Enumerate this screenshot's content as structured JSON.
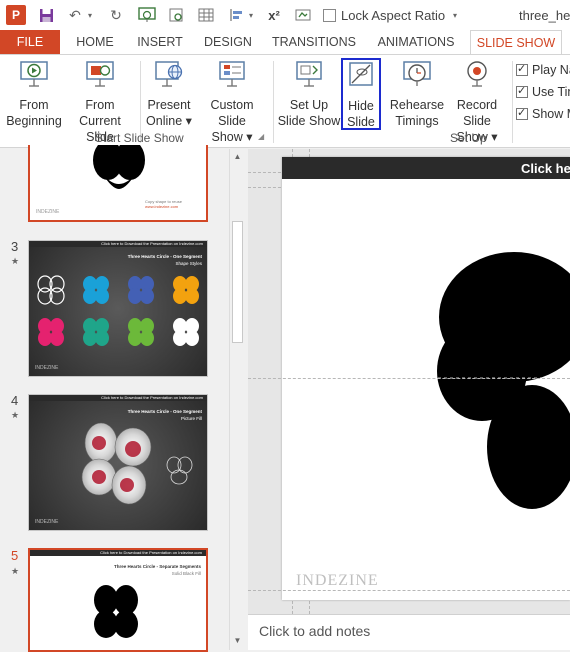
{
  "qat": {
    "lock_label": "Lock Aspect Ratio",
    "doc_title": "three_hea",
    "ppt_letter": "P",
    "superscript_label": "x²"
  },
  "tabs": [
    "FILE",
    "HOME",
    "INSERT",
    "DESIGN",
    "TRANSITIONS",
    "ANIMATIONS",
    "SLIDE SHOW"
  ],
  "active_tab": "SLIDE SHOW",
  "ribbon": {
    "from_beginning": [
      "From",
      "Beginning"
    ],
    "from_current": [
      "From",
      "Current Slide"
    ],
    "present_online": [
      "Present",
      "Online ▾"
    ],
    "custom_slide_show": [
      "Custom Slide",
      "Show ▾"
    ],
    "setup_slide_show": [
      "Set Up",
      "Slide Show"
    ],
    "hide_slide": [
      "Hide",
      "Slide"
    ],
    "rehearse_timings": [
      "Rehearse",
      "Timings"
    ],
    "record_slide_show": [
      "Record Slide",
      "Show ▾"
    ],
    "group_start": "Start Slide Show",
    "group_setup": "Set Up",
    "checks": [
      "Play Na",
      "Use Tin",
      "Show M"
    ]
  },
  "thumbnails": {
    "numbers": [
      "3",
      "4",
      "5"
    ],
    "star": "★",
    "slide3_title": "Three Hearts Circle - One Segment",
    "slide3_subtitle": "Shape Styles",
    "slide3_topbar": "Click here to Download the Presentation on Indezine.com",
    "slide4_title": "Three Hearts Circle - One Segment",
    "slide4_subtitle": "Picture Fill",
    "slide5_title": "Three Hearts Circle - Separate Segments",
    "slide5_subtitle": "Solid Black Fill",
    "brand": "INDEZINE"
  },
  "editor": {
    "topbar_text": "Click her",
    "watermark": "INDEZINE",
    "notes_placeholder": "Click to add notes"
  },
  "colors": {
    "accent": "#d24726",
    "highlight_box": "#1c2bcf",
    "clover_colors": [
      "#2a2a2a",
      "#1aa1d8",
      "#4360b5",
      "#f3a20f",
      "#e5226f",
      "#1fa58a",
      "#6cb93a",
      "#ffffff"
    ]
  }
}
